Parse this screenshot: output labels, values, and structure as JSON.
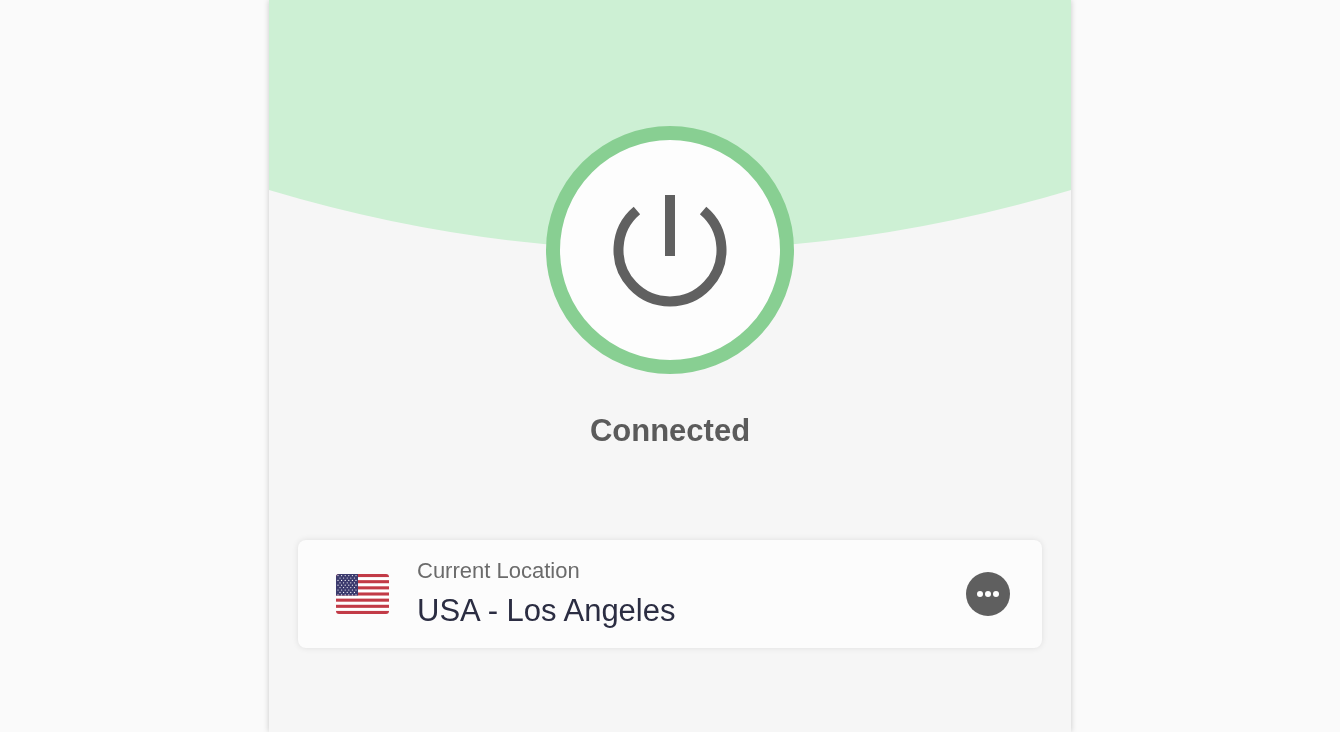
{
  "status": {
    "label": "Connected",
    "connected": true
  },
  "location": {
    "caption": "Current Location",
    "name": "USA - Los Angeles"
  }
}
